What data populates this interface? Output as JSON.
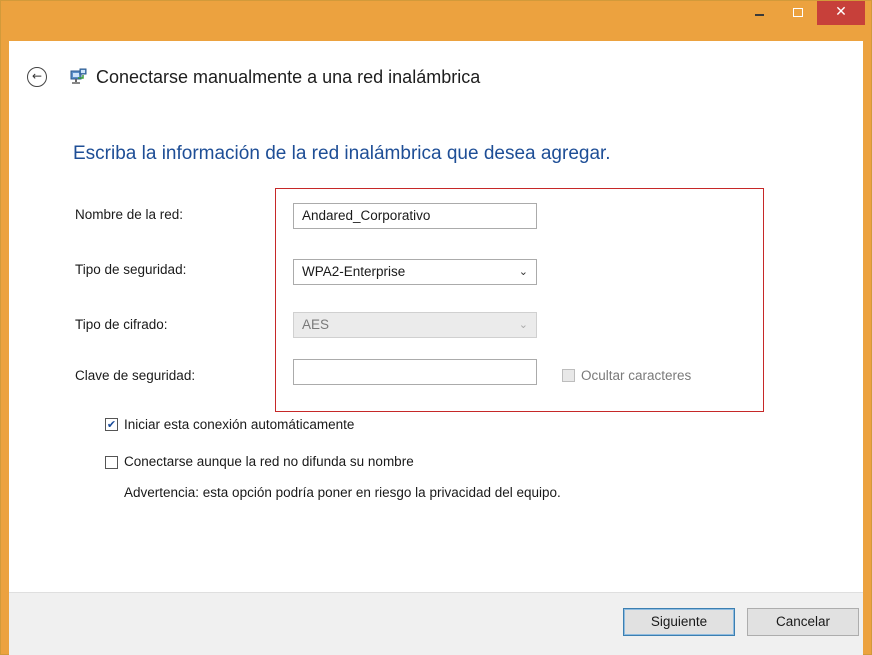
{
  "window": {
    "close_glyph": "✕",
    "minimize_label": "_",
    "maximize_label": "□"
  },
  "header": {
    "back_icon": "back-arrow-icon",
    "back_glyph": "←",
    "title": "Conectarse manualmente a una red inalámbrica"
  },
  "main": {
    "instruction": "Escriba la información de la red inalámbrica que desea agregar."
  },
  "form": {
    "network_name_label": "Nombre de la red:",
    "network_name_value": "Andared_Corporativo",
    "security_type_label": "Tipo de seguridad:",
    "security_type_value": "WPA2-Enterprise",
    "encryption_type_label": "Tipo de cifrado:",
    "encryption_type_value": "AES",
    "security_key_label": "Clave de seguridad:",
    "security_key_value": "",
    "hide_chars_label": "Ocultar caracteres",
    "hide_chars_checked": false
  },
  "options": {
    "auto_connect_label": "Iniciar esta conexión automáticamente",
    "auto_connect_checked": true,
    "hidden_network_label": "Conectarse aunque la red no difunda su nombre",
    "hidden_network_checked": false,
    "warning": "Advertencia: esta opción podría poner en riesgo la privacidad del equipo."
  },
  "footer": {
    "next_label": "Siguiente",
    "cancel_label": "Cancelar"
  },
  "colors": {
    "titlebar": "#eca23f",
    "close_button": "#c7403a",
    "instruction_text": "#1e4e96",
    "highlight_border": "#c62828"
  },
  "check_glyph": "✔",
  "chevron_glyph": "⌄"
}
